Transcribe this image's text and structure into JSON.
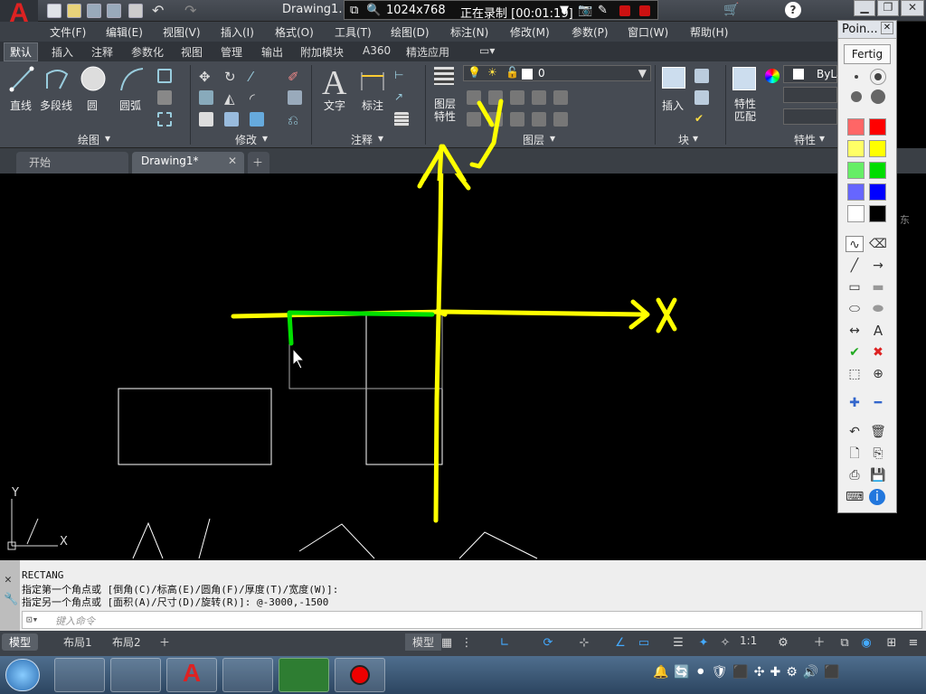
{
  "title_bar": {
    "doc_title": "Drawing1.",
    "recording_size": "1024x768",
    "recording_status": "正在录制 [00:01:19]"
  },
  "menu": [
    "文件(F)",
    "编辑(E)",
    "视图(V)",
    "插入(I)",
    "格式(O)",
    "工具(T)",
    "绘图(D)",
    "标注(N)",
    "修改(M)",
    "参数(P)",
    "窗口(W)",
    "帮助(H)"
  ],
  "ribbon_tabs": [
    "默认",
    "插入",
    "注释",
    "参数化",
    "视图",
    "管理",
    "输出",
    "附加模块",
    "A360",
    "精选应用"
  ],
  "ribbon": {
    "draw_tools": [
      "直线",
      "多段线",
      "圆",
      "圆弧"
    ],
    "panels": {
      "draw": "绘图",
      "modify": "修改",
      "annotate": "注释",
      "layers": "图层",
      "block": "块",
      "properties": "特性"
    },
    "text_label": "文字",
    "dim_label": "标注",
    "layer_props": "图层\n特性",
    "layer_value": "0",
    "insert_label": "插入",
    "match_label": "特性\n匹配",
    "bylayer": "ByLa"
  },
  "doc_tabs": {
    "start": "开始",
    "drawing": "Drawing1*"
  },
  "canvas": {
    "x_label": "X",
    "y_label": "Y",
    "ucs_x": "X",
    "ucs_y": "Y",
    "viewcube_side": "东",
    "ink_color": "#ffff00",
    "green_ink": "#00e000"
  },
  "command": {
    "lines": [
      "RECTANG",
      "指定第一个角点或 [倒角(C)/标高(E)/圆角(F)/厚度(T)/宽度(W)]:",
      "指定另一个角点或 [面积(A)/尺寸(D)/旋转(R)]: @-3000,-1500"
    ],
    "placeholder": "键入命令"
  },
  "status": {
    "tabs": [
      "模型",
      "布局1",
      "布局2"
    ],
    "model_btn": "模型",
    "scale": "1:1"
  },
  "pointer_panel": {
    "title": "Poin...",
    "button": "Fertig",
    "colors": [
      "#ff6666",
      "#ff0000",
      "#ffff66",
      "#ffff00",
      "#66ee66",
      "#00dd00",
      "#6666ff",
      "#0000ff",
      "#ffffff",
      "#000000"
    ]
  }
}
